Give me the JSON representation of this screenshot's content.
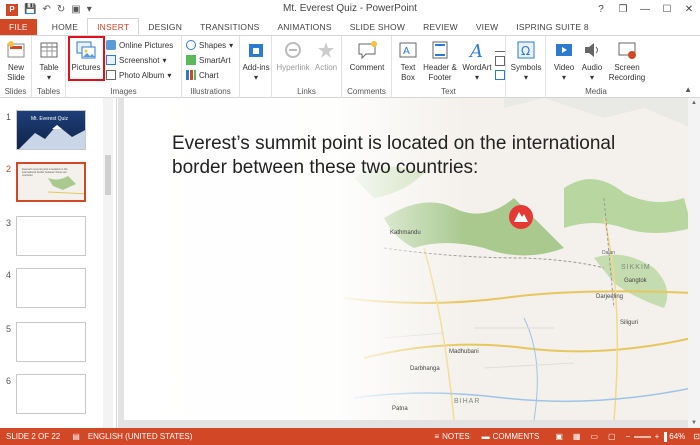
{
  "window": {
    "title": "Mt. Everest Quiz - PowerPoint"
  },
  "qat": {
    "save_icon": "save-icon",
    "undo_icon": "undo-icon",
    "redo_icon": "redo-icon",
    "start_icon": "start-from-beginning-icon"
  },
  "window_controls": {
    "help": "?",
    "restore": "❐",
    "minimize": "—",
    "maximize": "☐",
    "close": "✕"
  },
  "tabs": [
    "FILE",
    "HOME",
    "INSERT",
    "DESIGN",
    "TRANSITIONS",
    "ANIMATIONS",
    "SLIDE SHOW",
    "REVIEW",
    "VIEW",
    "ISPRING SUITE 8"
  ],
  "ribbon": {
    "new_slide": "New Slide",
    "table": "Table",
    "pictures": "Pictures",
    "online_pictures": "Online Pictures",
    "screenshot": "Screenshot",
    "photo_album": "Photo Album",
    "shapes": "Shapes",
    "smartart": "SmartArt",
    "chart": "Chart",
    "addins": "Add-ins",
    "hyperlink": "Hyperlink",
    "action": "Action",
    "comment": "Comment",
    "text_box": "Text Box",
    "header_footer": "Header & Footer",
    "wordart": "WordArt",
    "symbols": "Symbols",
    "video": "Video",
    "audio": "Audio",
    "screen_recording": "Screen Recording",
    "groups": {
      "slides": "Slides",
      "tables": "Tables",
      "images": "Images",
      "illustrations": "Illustrations",
      "links": "Links",
      "comments": "Comments",
      "text": "Text",
      "media": "Media"
    }
  },
  "slides_pane": {
    "numbers": [
      "1",
      "2",
      "3",
      "4",
      "5",
      "6"
    ],
    "slide1_title": "Mt. Everest Quiz",
    "slide2_snippet": "Everest's summit point is located on the international border between these two countries:"
  },
  "slide": {
    "title": "Everest’s summit point is located on the international border between these two countries:",
    "map_labels": {
      "kathmandu": "Kathmandu",
      "sikkim": "SIKKIM",
      "gangtok": "Gangtok",
      "darjeeling": "Darjeeling",
      "siliguri": "Siliguri",
      "madhubani": "Madhubani",
      "darbhanga": "Darbhanga",
      "bihar": "BIHAR",
      "patna": "Patna",
      "dalan": "Dalan"
    },
    "marker_icon": "mountain-icon"
  },
  "status": {
    "slide_info": "SLIDE 2 OF 22",
    "language": "ENGLISH (UNITED STATES)",
    "notes": "NOTES",
    "comments": "COMMENTS",
    "zoom": "64%"
  },
  "colors": {
    "accent": "#d24726",
    "highlight": "#e0101c",
    "map_green": "#a9c98f",
    "map_bg": "#f4f1ec"
  }
}
